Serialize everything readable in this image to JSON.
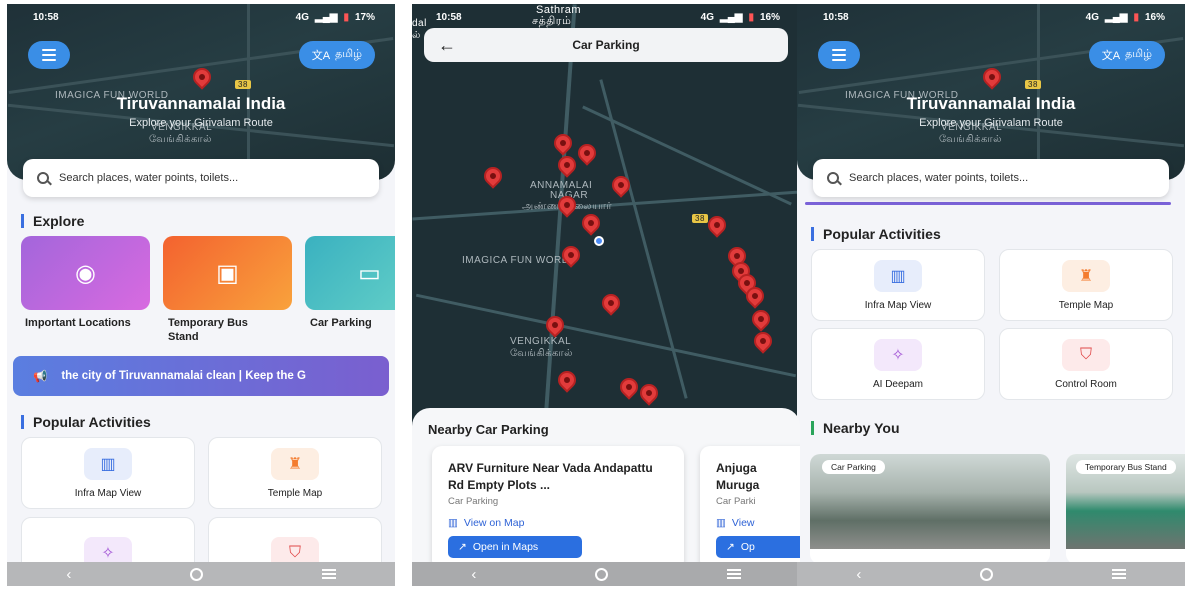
{
  "status": {
    "time": "10:58",
    "battery_p1": "17%",
    "battery_p2": "16%",
    "battery_p3": "16%",
    "signal": "4G"
  },
  "home": {
    "lang_label": "தமிழ்",
    "hero_title": "Tiruvannamalai India",
    "hero_subtitle": "Explore your Girivalam Route",
    "map_labels": {
      "imagica": "IMAGICA FUN WORLD",
      "vengikkal": "VENGIKKAL",
      "vengikkal_ta": "வேங்கிக்கால்",
      "road": "38"
    },
    "search_placeholder": "Search places, water points, toilets...",
    "explore_title": "Explore",
    "explore": [
      {
        "label": "Important Locations",
        "color": "#b85fd6",
        "icon": "location-icon"
      },
      {
        "label": "Temporary Bus Stand",
        "color": "#f47c2f",
        "icon": "bus-icon"
      },
      {
        "label": "Car Parking",
        "color": "#3fb5c4",
        "icon": "car-icon"
      }
    ],
    "banner_text": "the city of Tiruvannamalai clean | Keep the G",
    "popular_title": "Popular Activities",
    "activities": [
      {
        "label": "Infra Map View",
        "icon": "map-icon"
      },
      {
        "label": "Temple Map",
        "icon": "temple-icon"
      },
      {
        "label": "AI Deepam",
        "icon": "sparkle-icon"
      },
      {
        "label": "Control Room",
        "icon": "shield-icon"
      }
    ],
    "nearby_title": "Nearby You",
    "nearby": [
      {
        "tag": "Car Parking"
      },
      {
        "tag": "Temporary Bus Stand"
      }
    ]
  },
  "parking": {
    "title": "Car Parking",
    "map_labels": {
      "sathram": "Sathram",
      "sathram_ta": "சத்திரம்",
      "annamalai": "ANNAMALAI",
      "nagar": "NAGAR",
      "annamalai_ta": "அண்ணாமலையார்",
      "imagica": "IMAGICA FUN WORLD",
      "vengikkal": "VENGIKKAL",
      "vengikkal_ta": "வேங்கிக்கால்",
      "road": "38",
      "left_edge": "dal",
      "left_edge_ta": "ல்"
    },
    "sheet_title": "Nearby Car Parking",
    "cards": [
      {
        "name": "ARV Furniture Near Vada Andapattu Rd Empty Plots ...",
        "type": "Car Parking",
        "view_label": "View on Map",
        "open_label": "Open in Maps"
      },
      {
        "name": "Anjuga Muruga",
        "type": "Car Parki",
        "view_label": "View",
        "open_label": "Op"
      }
    ]
  }
}
